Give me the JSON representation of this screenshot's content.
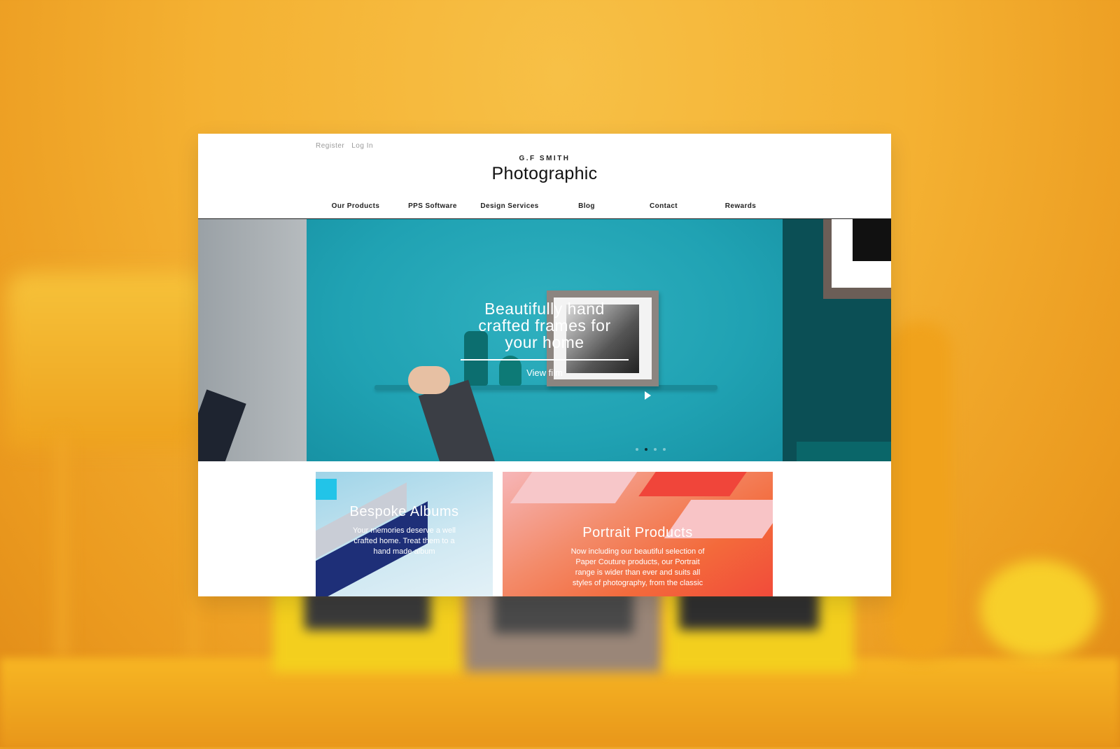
{
  "account": {
    "register": "Register",
    "login": "Log In"
  },
  "logo": {
    "small": "G.F SMITH",
    "big": "Photographic"
  },
  "nav": [
    "Our Products",
    "PPS Software",
    "Design Services",
    "Blog",
    "Contact",
    "Rewards"
  ],
  "hero": {
    "title_lines": [
      "Beautifully hand",
      "crafted frames for",
      "your home"
    ],
    "link": "View film",
    "slides": 4,
    "active_slide": 2
  },
  "tiles": {
    "albums": {
      "title": "Bespoke Albums",
      "desc_lines": [
        "Your memories deserve a well",
        "crafted home. Treat them to a",
        "hand made album"
      ]
    },
    "portrait": {
      "title": "Portrait Products",
      "desc_lines": [
        "Now including our beautiful selection of",
        "Paper Couture products, our Portrait",
        "range is wider than ever and suits all",
        "styles of photography, from the classic"
      ]
    }
  },
  "colors": {
    "hero_bg": "#20a2b3",
    "portrait_bg": "#f36a3b",
    "page_bg": "#f4b132"
  }
}
